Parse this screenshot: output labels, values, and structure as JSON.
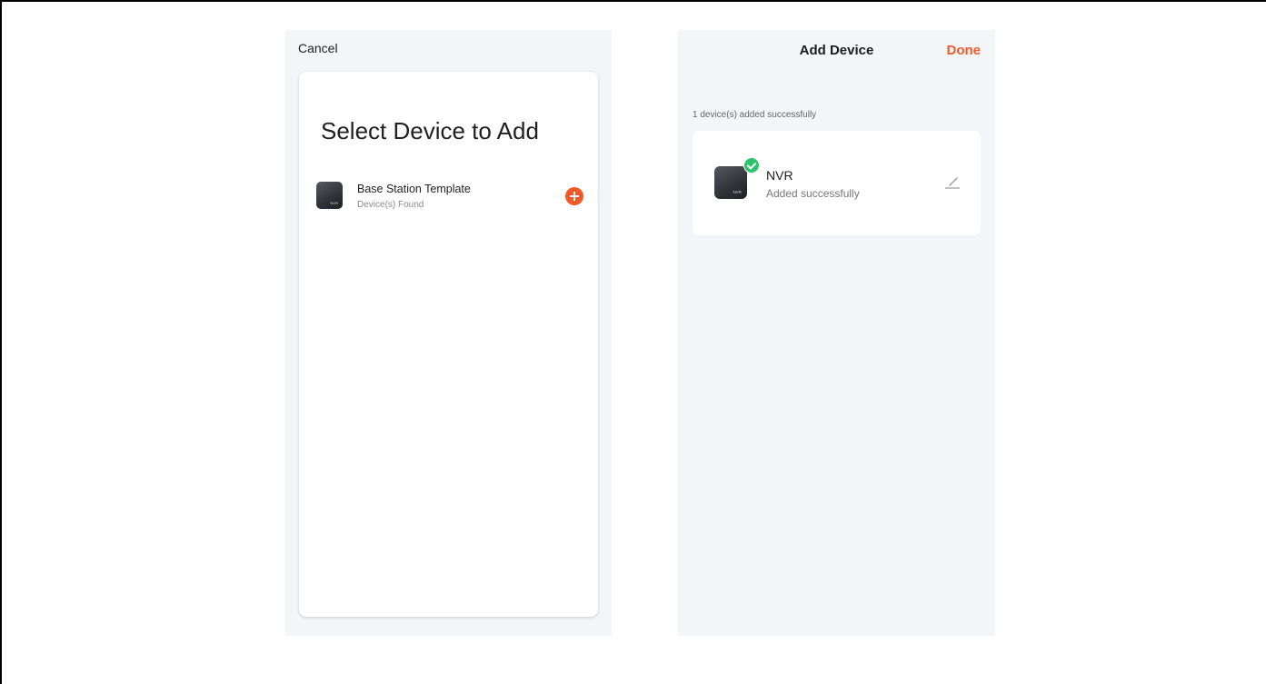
{
  "left_screen": {
    "cancel_label": "Cancel",
    "title": "Select Device to Add",
    "device": {
      "name": "Base Station Template",
      "subtitle": "Device(s) Found",
      "icon_tag": "NVR",
      "icon": "plus-circle-icon"
    }
  },
  "right_screen": {
    "nav_title": "Add Device",
    "done_label": "Done",
    "success_count": "1 device(s) added successfully",
    "device": {
      "name": "NVR",
      "status": "Added successfully",
      "icon_tag": "NVR",
      "badge_icon": "check-icon",
      "edit_icon": "pencil-icon"
    }
  },
  "colors": {
    "accent": "#f05a28",
    "success": "#2ec26b",
    "screen_bg": "#f4f5f9"
  }
}
